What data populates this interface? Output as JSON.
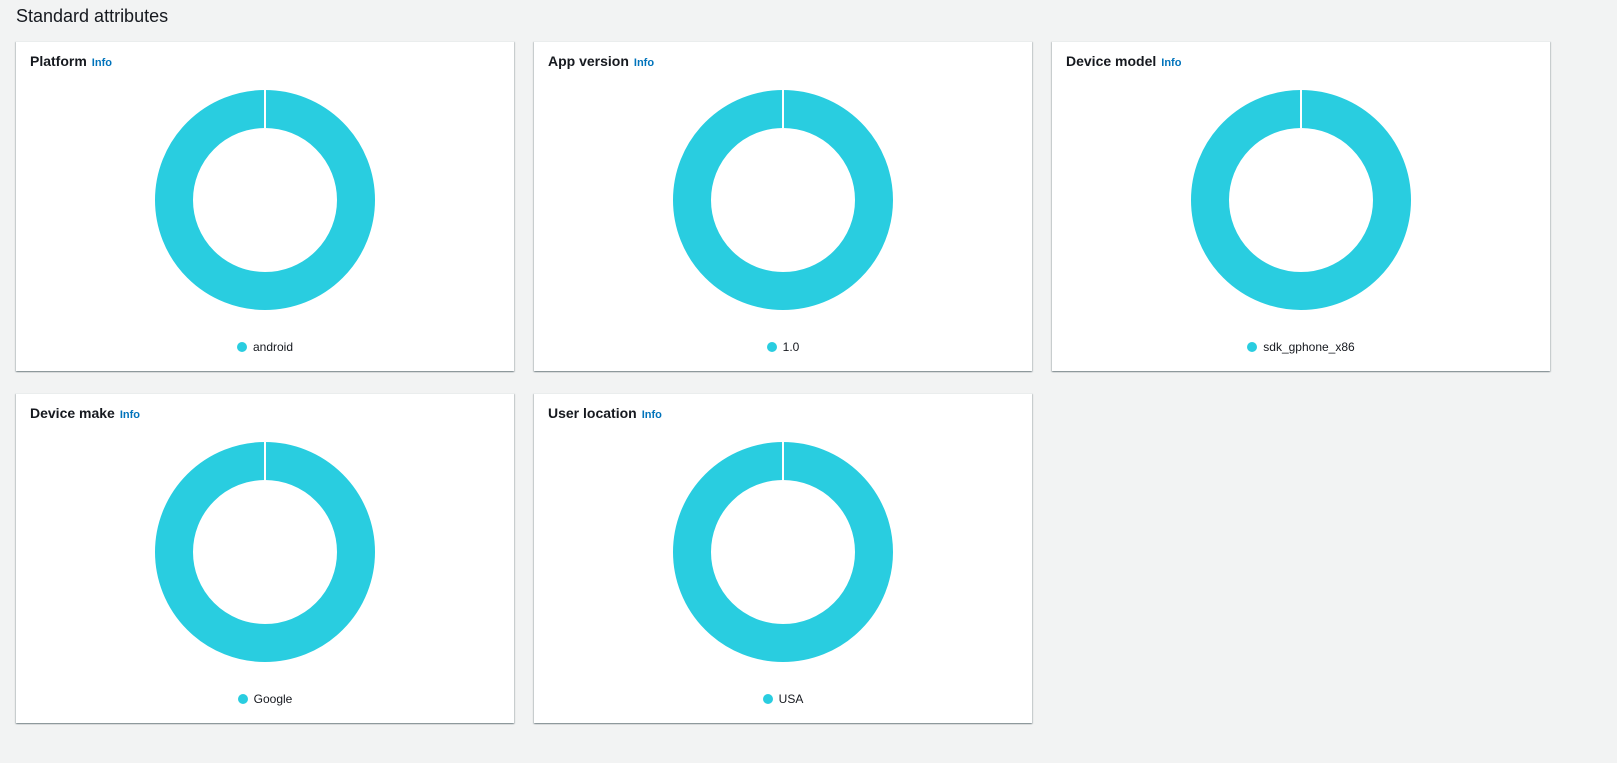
{
  "section": {
    "title": "Standard attributes"
  },
  "colors": {
    "slice": "#29cde0",
    "background": "#f2f3f3",
    "info_link": "#0073bb"
  },
  "cards": [
    {
      "title": "Platform",
      "info": "Info",
      "chart_data": {
        "type": "pie",
        "categories": [
          "android"
        ],
        "values": [
          100
        ]
      }
    },
    {
      "title": "App version",
      "info": "Info",
      "chart_data": {
        "type": "pie",
        "categories": [
          "1.0"
        ],
        "values": [
          100
        ]
      }
    },
    {
      "title": "Device model",
      "info": "Info",
      "chart_data": {
        "type": "pie",
        "categories": [
          "sdk_gphone_x86"
        ],
        "values": [
          100
        ]
      }
    },
    {
      "title": "Device make",
      "info": "Info",
      "chart_data": {
        "type": "pie",
        "categories": [
          "Google"
        ],
        "values": [
          100
        ]
      }
    },
    {
      "title": "User location",
      "info": "Info",
      "chart_data": {
        "type": "pie",
        "categories": [
          "USA"
        ],
        "values": [
          100
        ]
      }
    }
  ]
}
